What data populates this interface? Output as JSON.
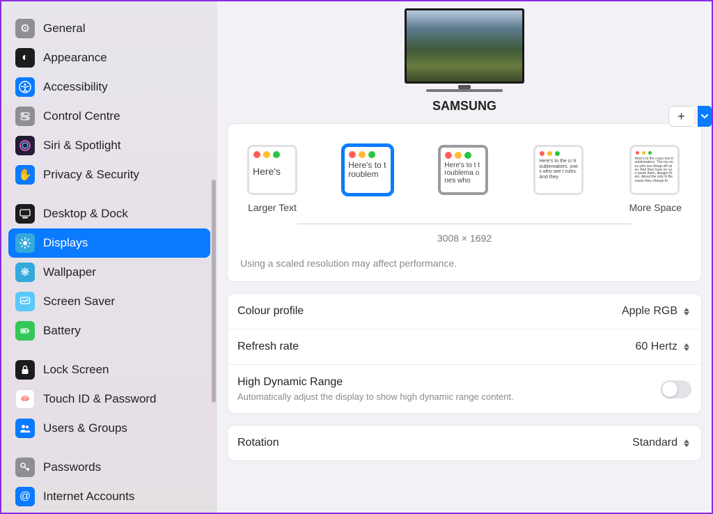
{
  "sidebar": {
    "items": [
      {
        "label": "General",
        "icon_bg": "#8e8e93",
        "icon_glyph": "⚙"
      },
      {
        "label": "Appearance",
        "icon_bg": "#1c1c1e",
        "icon_glyph": "◐"
      },
      {
        "label": "Accessibility",
        "icon_bg": "#0a7aff",
        "icon_glyph": "✦"
      },
      {
        "label": "Control Centre",
        "icon_bg": "#8e8e93",
        "icon_glyph": "⊟"
      },
      {
        "label": "Siri & Spotlight",
        "icon_bg": "linear-gradient(135deg,#ff2d55,#af52de,#007aff)",
        "icon_glyph": "◉"
      },
      {
        "label": "Privacy & Security",
        "icon_bg": "#0a7aff",
        "icon_glyph": "✋"
      }
    ],
    "items2": [
      {
        "label": "Desktop & Dock",
        "icon_bg": "#1c1c1e",
        "icon_glyph": "▣"
      },
      {
        "label": "Displays",
        "icon_bg": "#34aadc",
        "icon_glyph": "☀",
        "selected": true
      },
      {
        "label": "Wallpaper",
        "icon_bg": "#34aadc",
        "icon_glyph": "❋"
      },
      {
        "label": "Screen Saver",
        "icon_bg": "#5ac8fa",
        "icon_glyph": "▦"
      },
      {
        "label": "Battery",
        "icon_bg": "#34c759",
        "icon_glyph": "▮"
      }
    ],
    "items3": [
      {
        "label": "Lock Screen",
        "icon_bg": "#1c1c1e",
        "icon_glyph": "🔒"
      },
      {
        "label": "Touch ID & Password",
        "icon_bg": "#ffffff",
        "icon_glyph": "⊚",
        "icon_color": "#ff3b30"
      },
      {
        "label": "Users & Groups",
        "icon_bg": "#0a7aff",
        "icon_glyph": "👥"
      }
    ],
    "items4": [
      {
        "label": "Passwords",
        "icon_bg": "#8e8e93",
        "icon_glyph": "🔑"
      },
      {
        "label": "Internet Accounts",
        "icon_bg": "#0a7aff",
        "icon_glyph": "@"
      }
    ]
  },
  "header": {
    "display_name": "SAMSUNG",
    "add_glyph": "+",
    "chevron_glyph": "⌄"
  },
  "resolution": {
    "larger_text": "Larger Text",
    "more_space": "More Space",
    "value": "3008 × 1692",
    "thumbs": [
      {
        "txt": "Here's"
      },
      {
        "txt": "Here's to troublem"
      },
      {
        "txt": "Here's to t troublema ones who"
      },
      {
        "txt": "Here's to the cr troublemakers.  ones who see t rules. And they"
      },
      {
        "txt": "Here's to the crazy one troublemakers. The rou ones who see things dif rules. And they have no can quote them, disagre them. About the only th Because they change th"
      }
    ],
    "note": "Using a scaled resolution may affect performance."
  },
  "settings": {
    "colour_profile": {
      "label": "Colour profile",
      "value": "Apple RGB"
    },
    "refresh_rate": {
      "label": "Refresh rate",
      "value": "60 Hertz"
    },
    "hdr": {
      "label": "High Dynamic Range",
      "sub": "Automatically adjust the display to show high dynamic range content.",
      "on": false
    },
    "rotation": {
      "label": "Rotation",
      "value": "Standard"
    }
  }
}
